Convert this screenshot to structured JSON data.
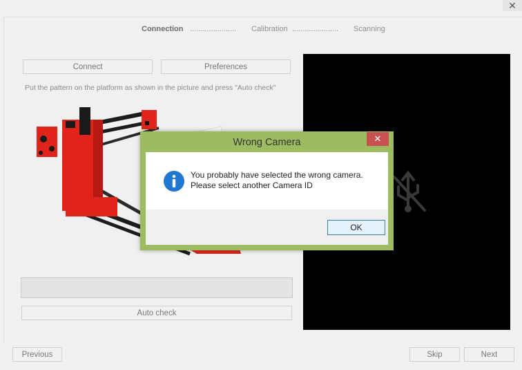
{
  "window": {
    "close_glyph": "✕"
  },
  "steps": [
    {
      "label": "Connection",
      "active": true
    },
    {
      "label": "......................"
    },
    {
      "label": "Calibration"
    },
    {
      "label": "......................"
    },
    {
      "label": "Scanning"
    }
  ],
  "buttons": {
    "connect": "Connect",
    "preferences": "Preferences",
    "auto_check": "Auto check",
    "previous": "Previous",
    "skip": "Skip",
    "next": "Next"
  },
  "instructions": "Put the pattern on the platform as shown in the picture and press \"Auto check\"",
  "dialog": {
    "title": "Wrong Camera",
    "close_glyph": "✕",
    "message_line1": "You probably have selected the wrong camera.",
    "message_line2": "Please select another Camera ID",
    "ok_label": "OK"
  },
  "icons": {
    "info": "info-icon",
    "usb_disconnected": "usb-disconnected-icon",
    "scanner": "scanner-illustration"
  },
  "colors": {
    "dialog_border": "#9dbb61",
    "close_red": "#c75050",
    "info_blue": "#1f77d0",
    "scanner_red": "#e0231b"
  }
}
